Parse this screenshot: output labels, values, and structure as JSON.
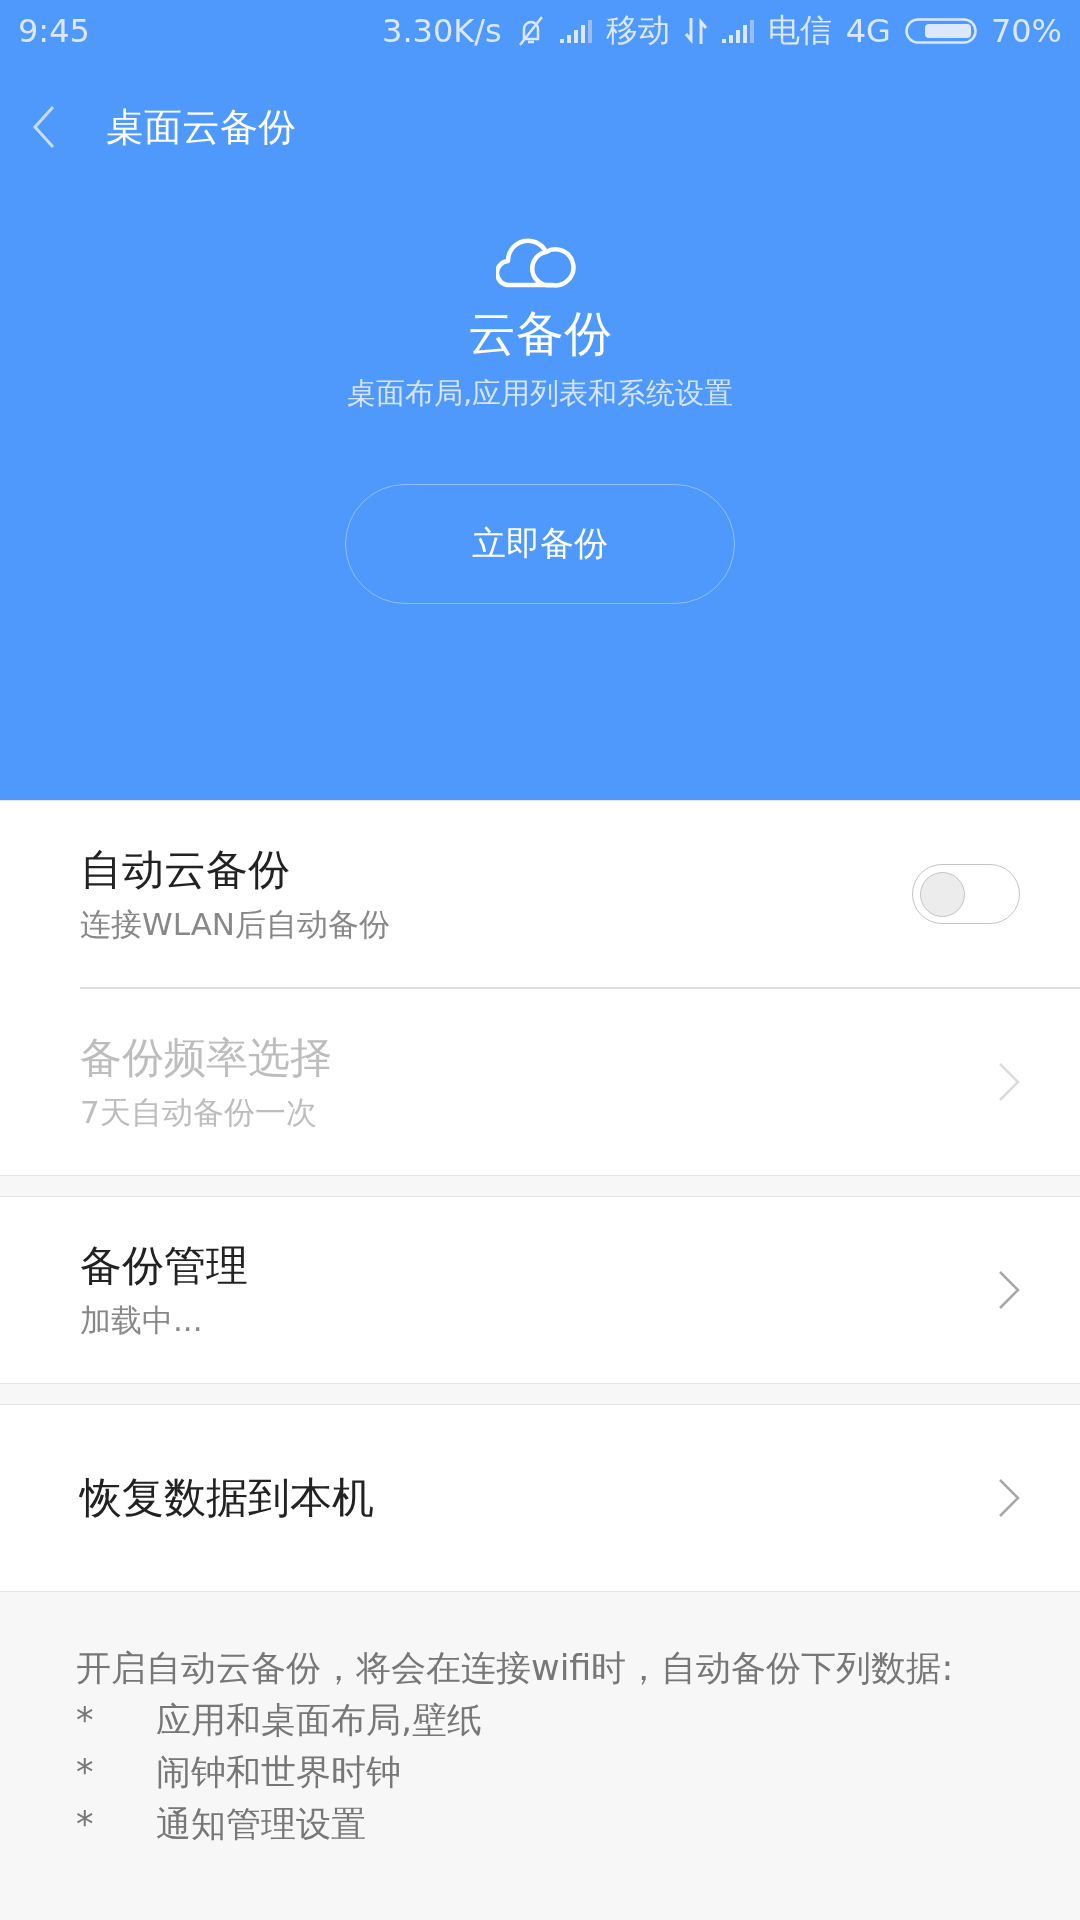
{
  "status_bar": {
    "time": "9:45",
    "speed": "3.30K/s",
    "carrier_1": "移动",
    "carrier_2": "电信",
    "network": "4G",
    "battery": "70%"
  },
  "toolbar": {
    "title": "桌面云备份"
  },
  "hero": {
    "title": "云备份",
    "subtitle": "桌面布局,应用列表和系统设置",
    "button": "立即备份"
  },
  "groups": [
    {
      "items": [
        {
          "kind": "toggle",
          "title": "自动云备份",
          "subtitle": "连接WLAN后自动备份",
          "on": false,
          "disabled": false
        },
        {
          "kind": "link",
          "title": "备份频率选择",
          "subtitle": "7天自动备份一次",
          "disabled": true
        }
      ]
    },
    {
      "items": [
        {
          "kind": "link",
          "title": "备份管理",
          "subtitle": "加载中...",
          "disabled": false
        }
      ]
    },
    {
      "items": [
        {
          "kind": "link",
          "title": "恢复数据到本机",
          "disabled": false
        }
      ]
    }
  ],
  "footer": {
    "intro": "开启自动云备份，将会在连接wifi时，自动备份下列数据:",
    "bullets": [
      {
        "marker": "*",
        "text": "应用和桌面布局,壁纸"
      },
      {
        "marker": "*",
        "text": "闹钟和世界时钟"
      },
      {
        "marker": "*",
        "text": "通知管理设置"
      }
    ]
  }
}
